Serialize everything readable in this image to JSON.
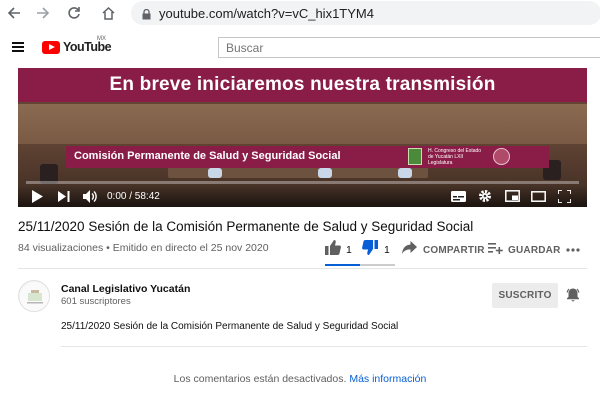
{
  "browser": {
    "url": "youtube.com/watch?v=vC_hix1TYM4"
  },
  "header": {
    "logo_text": "YouTube",
    "country_code": "MX",
    "search_placeholder": "Buscar"
  },
  "player": {
    "banner_top": "En breve iniciaremos nuestra transmisión",
    "banner_bottom": "Comisión Permanente de Salud y Seguridad Social",
    "seal_text": "H. Congreso del Estado de Yucatán LXII Legislatura",
    "time_display": "0:00 / 58:42",
    "progress_fraction": 0.0,
    "colors": {
      "banner": "#8a1d47",
      "progress": "#ff0000"
    }
  },
  "video": {
    "title": "25/11/2020 Sesión de la Comisión Permanente de Salud y Seguridad Social",
    "meta": "84 visualizaciones • Emitido en directo el 25 nov 2020",
    "likes": "1",
    "dislikes": "1",
    "like_ratio": 0.5,
    "share_label": "COMPARTIR",
    "save_label": "GUARDAR"
  },
  "channel": {
    "name": "Canal Legislativo Yucatán",
    "subscribers": "601 suscriptores",
    "subscribe_label": "SUSCRITO",
    "description": "25/11/2020 Sesión de la Comisión Permanente de Salud y Seguridad Social"
  },
  "comments": {
    "disabled_text": "Los comentarios están desactivados.",
    "more_info_link": "Más información"
  },
  "icons": [
    "back-arrow-icon",
    "forward-arrow-icon",
    "reload-icon",
    "lock-icon",
    "menu-icon",
    "play-icon",
    "next-icon",
    "volume-icon",
    "subtitles-icon",
    "settings-icon",
    "miniplayer-icon",
    "theater-icon",
    "fullscreen-icon",
    "thumbs-up-icon",
    "thumbs-down-icon",
    "share-icon",
    "playlist-add-icon",
    "more-icon",
    "bell-icon"
  ]
}
